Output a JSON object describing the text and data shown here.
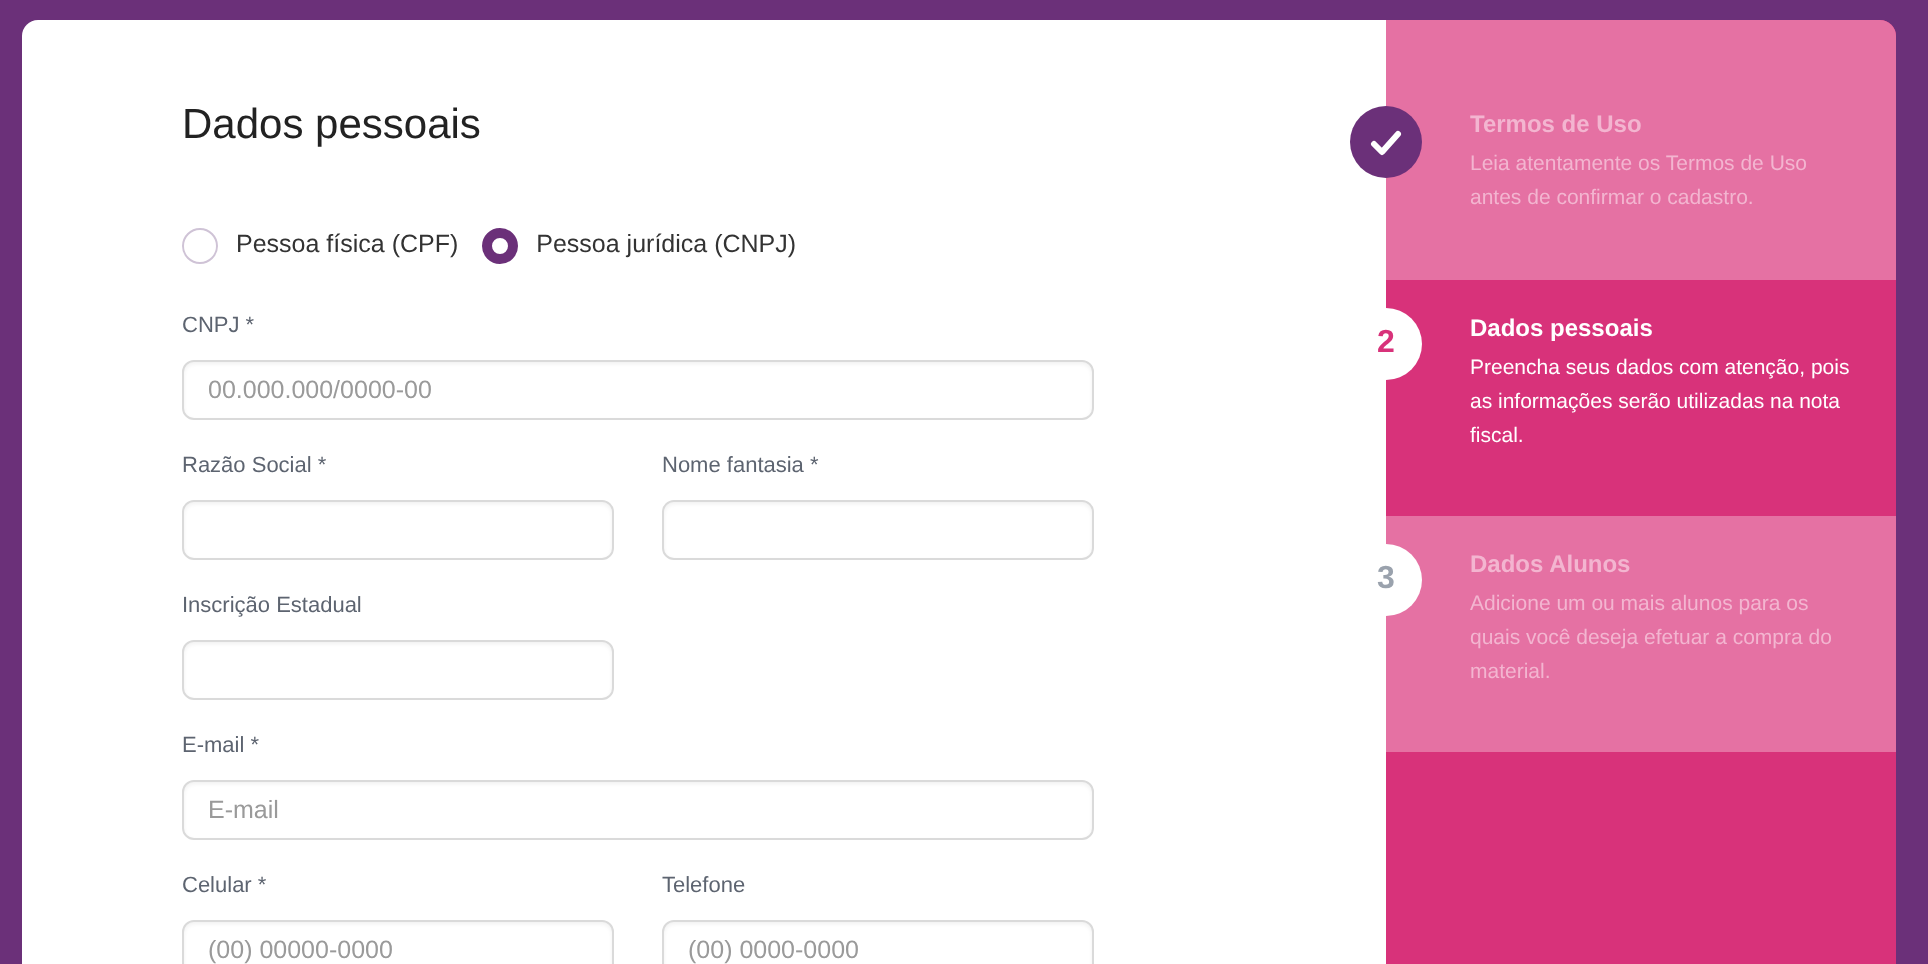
{
  "form": {
    "title": "Dados pessoais",
    "person_types": [
      {
        "label": "Pessoa física (CPF)",
        "selected": false
      },
      {
        "label": "Pessoa jurídica (CNPJ)",
        "selected": true
      }
    ],
    "rows": [
      [
        {
          "label": "CNPJ *",
          "placeholder": "00.000.000/0000-00"
        }
      ],
      [
        {
          "label": "Razão Social *"
        },
        {
          "label": "Nome fantasia *"
        }
      ],
      [
        {
          "label": "Inscrição Estadual"
        }
      ],
      [
        {
          "label": "E-mail *",
          "placeholder": "E-mail"
        }
      ],
      [
        {
          "label": "Celular *",
          "placeholder": "(00) 00000-0000"
        },
        {
          "label": "Telefone",
          "placeholder": "(00) 0000-0000"
        }
      ]
    ]
  },
  "steps": [
    {
      "completed": true,
      "selected": false,
      "title": "Termos de Uso",
      "text": "Leia atentamente os Termos de Uso antes de confirmar o cadastro."
    },
    {
      "completed": false,
      "selected": true,
      "number": "2",
      "title": "Dados pessoais",
      "text": "Preencha seus dados com atenção, pois as informações serão utilizadas na nota fiscal."
    },
    {
      "completed": false,
      "selected": false,
      "number": "3",
      "title": "Dados Alunos",
      "text": "Adicione um ou mais alunos para os quais você deseja efetuar a compra do material."
    }
  ]
}
